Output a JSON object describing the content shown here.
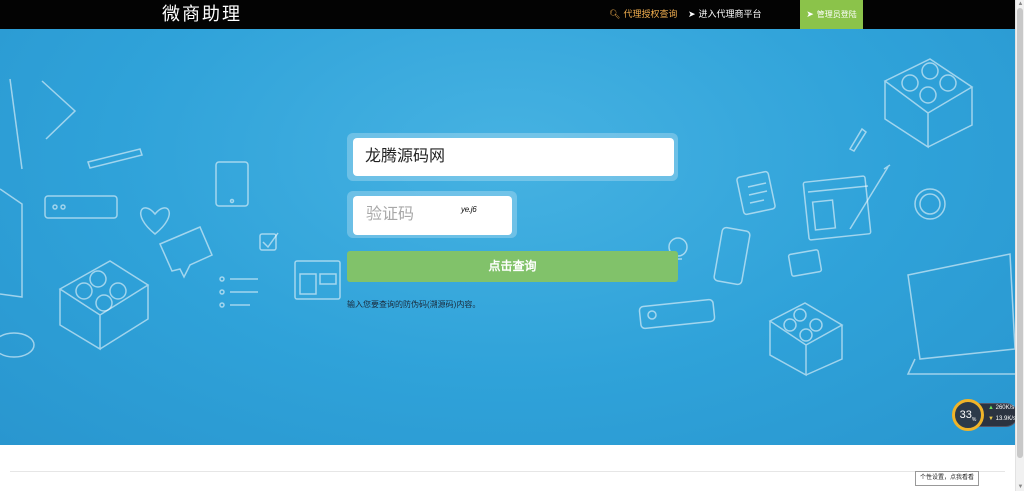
{
  "header": {
    "brand": "微商助理",
    "nav": {
      "agent_query": {
        "icon": "search-icon",
        "label": "代理授权查询"
      },
      "enter_platform": {
        "icon": "rocket-icon",
        "label": "进入代理商平台"
      },
      "admin_login": {
        "icon": "rocket-icon",
        "label": "管理员登陆"
      }
    }
  },
  "form": {
    "query_value": "龙腾源码网",
    "captcha_placeholder": "验证码",
    "captcha_text": "ye.j6",
    "submit_label": "点击查询",
    "hint": "输入您要查询的防伪码(溯源码)内容。"
  },
  "net_widget": {
    "percent": "33",
    "percent_unit": "%",
    "up": "260",
    "up_unit": "K/s",
    "down": "13.9",
    "down_unit": "K/s"
  },
  "tooltip": "个性设置，点我看看",
  "colors": {
    "topbar": "#030303",
    "hero": "#2fa2d9",
    "accent_green": "#8bc34a",
    "button_green": "#81c26a",
    "nav_highlight": "#f0ad4e"
  }
}
